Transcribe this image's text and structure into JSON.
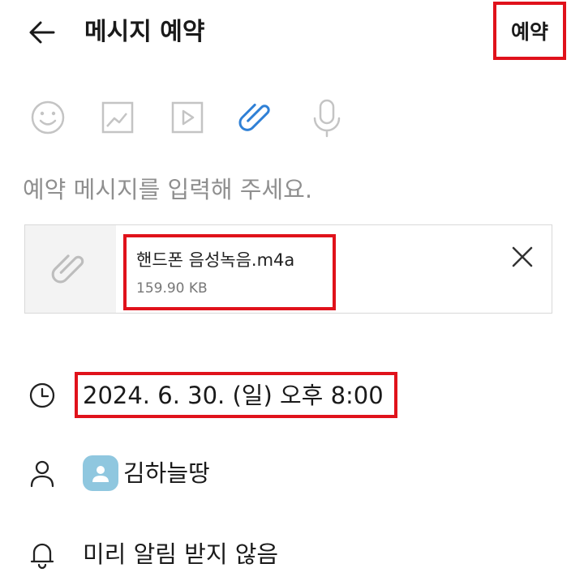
{
  "header": {
    "title": "메시지 예약",
    "submit_label": "예약",
    "back_icon": "arrow-left-icon"
  },
  "toolbar": {
    "icons": [
      "emoji-icon",
      "image-icon",
      "video-icon",
      "attachment-icon",
      "microphone-icon"
    ],
    "active_icon": "attachment-icon",
    "active_color": "#2f80d6",
    "inactive_color": "#c4c4c4"
  },
  "message": {
    "placeholder": "예약 메시지를 입력해 주세요."
  },
  "attachment": {
    "file_name": "핸드폰 음성녹음.m4a",
    "file_size": "159.90 KB",
    "thumb_icon": "paperclip-icon",
    "remove_icon": "close-icon"
  },
  "schedule": {
    "datetime": "2024. 6. 30. (일) 오후 8:00",
    "icon": "clock-icon"
  },
  "recipient": {
    "name": "김하늘땅",
    "icon": "person-icon",
    "avatar_color": "#8fc7df"
  },
  "notification": {
    "label": "미리 알림 받지 않음",
    "icon": "bell-icon"
  },
  "highlight_color": "#e0121b"
}
